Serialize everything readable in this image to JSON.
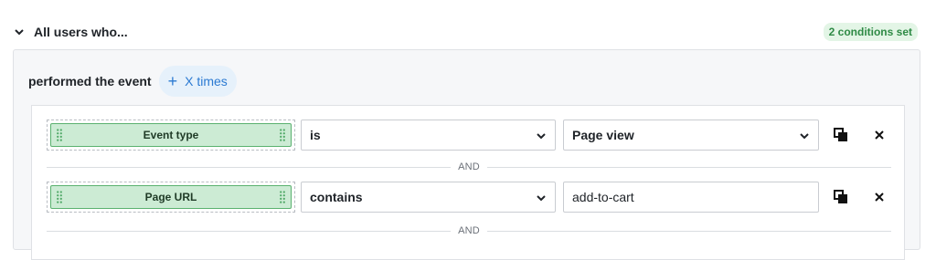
{
  "header": {
    "title": "All users who...",
    "badge": "2 conditions set",
    "badge_color": "#2e8a45"
  },
  "event": {
    "label": "performed the event",
    "frequency_button": "X times",
    "frequency_icon": "plus-icon"
  },
  "conditions": [
    {
      "property": "Event type",
      "operator": "is",
      "value": "Page view",
      "value_kind": "dropdown"
    },
    {
      "property": "Page URL",
      "operator": "contains",
      "value": "add-to-cart",
      "value_kind": "text"
    }
  ],
  "connectors": [
    "AND",
    "AND"
  ],
  "icons": {
    "collapse": "chevron-down-icon",
    "drag": "drag-handle-icon",
    "copy": "copy-icon",
    "remove": "close-icon"
  },
  "colors": {
    "chip_fill": "#ccebd4",
    "chip_border": "#5ab16f",
    "accent_blue": "#2b7ad2"
  }
}
